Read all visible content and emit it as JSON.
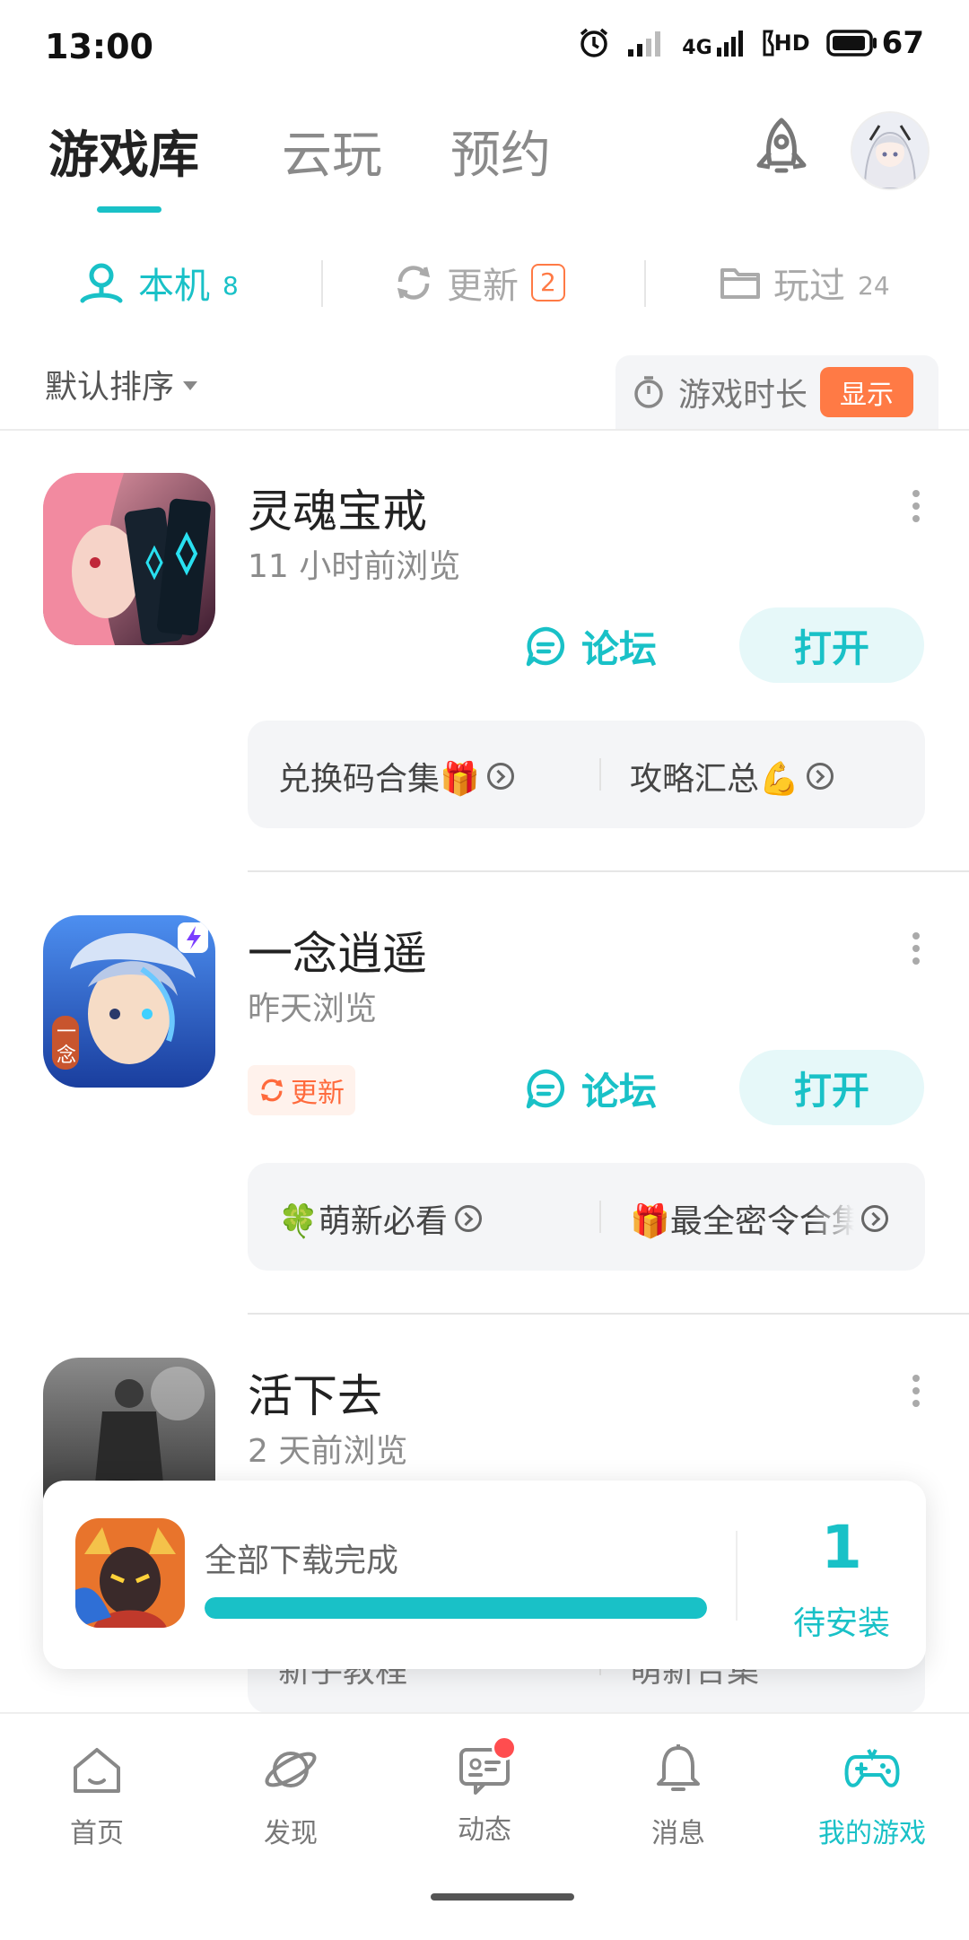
{
  "status_bar": {
    "time": "13:00",
    "network": "4G",
    "hd": "HD",
    "battery": "67"
  },
  "top_tabs": [
    "游戏库",
    "云玩",
    "预约"
  ],
  "sub_tabs": {
    "local": {
      "label": "本机",
      "count": "8"
    },
    "update": {
      "label": "更新",
      "count": "2"
    },
    "played": {
      "label": "玩过",
      "count": "24"
    }
  },
  "sort": {
    "label": "默认排序"
  },
  "playtime": {
    "label": "游戏时长",
    "toggle": "显示"
  },
  "games": [
    {
      "name": "灵魂宝戒",
      "sub": "11 小时前浏览",
      "forum": "论坛",
      "open": "打开",
      "links": [
        "兑换码合集🎁",
        "攻略汇总💪"
      ]
    },
    {
      "name": "一念逍遥",
      "sub": "昨天浏览",
      "update_tag": "更新",
      "forum": "论坛",
      "open": "打开",
      "links": [
        "🍀萌新必看",
        "🎁最全密令合集"
      ],
      "icon_text": "一念"
    },
    {
      "name": "活下去",
      "sub": "2 天前浏览",
      "links": [
        "新手教程",
        "萌新合集"
      ]
    }
  ],
  "download": {
    "label": "全部下载完成",
    "progress": 1.0,
    "count": "1",
    "pending": "待安装"
  },
  "bottom_nav": [
    "首页",
    "发现",
    "动态",
    "消息",
    "我的游戏"
  ],
  "colors": {
    "accent": "#19c1c7",
    "orange": "#ff7a45"
  }
}
